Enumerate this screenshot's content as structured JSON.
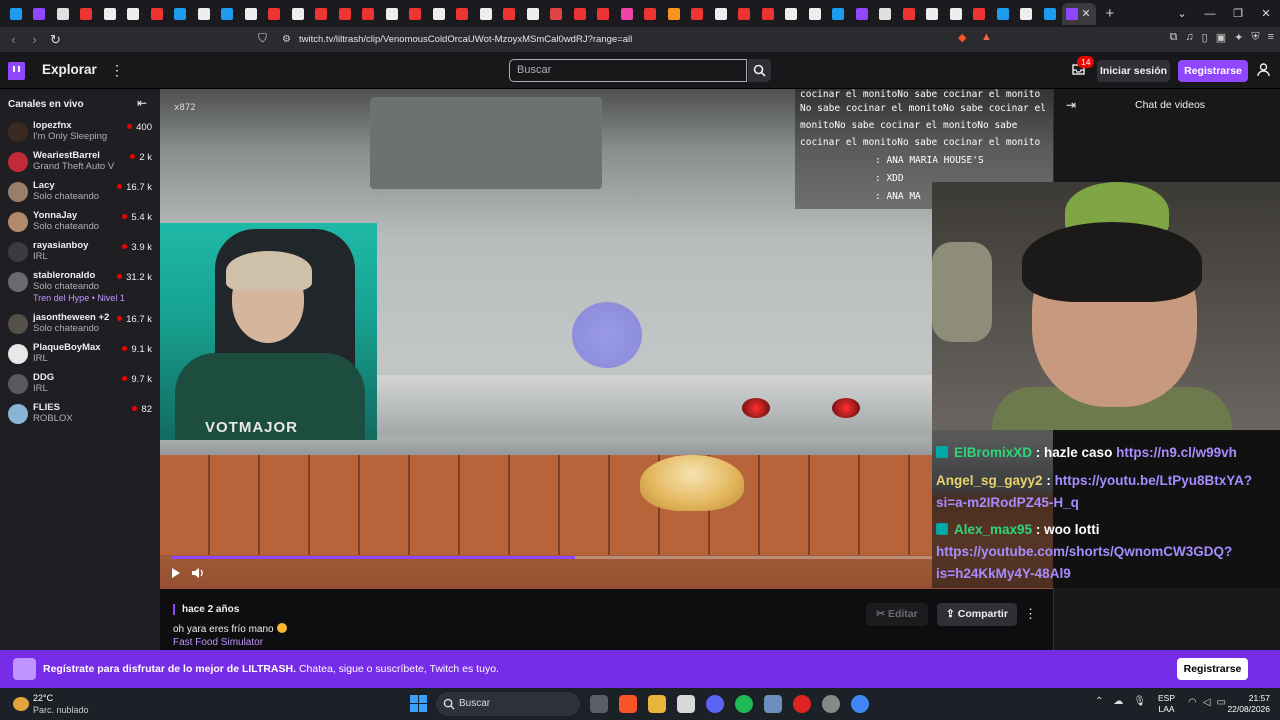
{
  "browser": {
    "url": "twitch.tv/liltrash/clip/VenomousColdOrcaUWot-MzoyxMSmCal0wdRJ?range=all",
    "tab_count_visible": 43
  },
  "topnav": {
    "explore_label": "Explorar",
    "search_placeholder": "Buscar",
    "notifications_count": "14",
    "login_label": "Iniciar sesión",
    "register_label": "Registrarse"
  },
  "sidebar": {
    "heading": "Canales en vivo",
    "channels": [
      {
        "name": "lopezfnx",
        "game": "I'm Only Sleeping",
        "viewers": "400",
        "color": "#3a2a22"
      },
      {
        "name": "WeariestBarrel",
        "game": "Grand Theft Auto V",
        "viewers": "2 k",
        "color": "#c22a3a"
      },
      {
        "name": "Lacy",
        "game": "Solo chateando",
        "viewers": "16.7 k",
        "color": "#9a7d6a"
      },
      {
        "name": "YonnaJay",
        "game": "Solo chateando",
        "viewers": "5.4 k",
        "color": "#b08a6a"
      },
      {
        "name": "rayasianboy",
        "game": "IRL",
        "viewers": "3.9 k",
        "color": "#3c3c40"
      },
      {
        "name": "stableronaldo",
        "game": "Solo chateando",
        "viewers": "31.2 k",
        "color": "#6a6a6e",
        "hype": "Tren del Hype • Nivel 1"
      },
      {
        "name": "jasontheween +2",
        "game": "Solo chateando",
        "viewers": "16.7 k",
        "color": "#55504a"
      },
      {
        "name": "PlaqueBoyMax",
        "game": "IRL",
        "viewers": "9.1 k",
        "color": "#e8e8e8"
      },
      {
        "name": "DDG",
        "game": "IRL",
        "viewers": "9.7 k",
        "color": "#5a5a5e"
      },
      {
        "name": "FLIES",
        "game": "ROBLOX",
        "viewers": "82",
        "color": "#8ab4d4"
      }
    ]
  },
  "video": {
    "counter_text": "x872",
    "progress": 0.53,
    "overlay_chat": [
      "cocinar el monitoNo sabe cocinar el monito",
      "No sabe cocinar el monitoNo sabe cocinar el",
      "monitoNo sabe cocinar el monitoNo sabe",
      "cocinar el monitoNo sabe cocinar el monito",
      ": ANA MARIA HOUSE'S",
      ": XDD",
      ": ANA MA"
    ],
    "webcam_shirt_text": "VOTMAJOR",
    "stream_chat": [
      {
        "user": "ElBromixXD",
        "msg": "hazle caso",
        "link": "https://n9.cl/w99vh"
      },
      {
        "user": "Angel_sg_gayy2",
        "msg": "",
        "link": "https://youtu.be/LtPyu8BtxYA?",
        "link2": "si=a-m2IRodPZ45-H_q"
      },
      {
        "user": "Alex_max95",
        "msg": "woo lotti",
        "link": "https://youtube.com/shorts/QwnomCW3GDQ?",
        "link2": "is=h24KkMy4Y-48Al9"
      }
    ]
  },
  "clip": {
    "time_ago": "hace 2 años",
    "title": "oh yara eres frío mano",
    "game": "Fast Food Simulator",
    "edit_label": "Editar",
    "share_label": "Compartir"
  },
  "chat_panel": {
    "title": "Chat de videos"
  },
  "banner": {
    "bold_text": "Regístrate para disfrutar de lo mejor de LILTRASH.",
    "text": " Chatea, sigue o suscríbete, Twitch es tuyo.",
    "button_label": "Registrarse"
  },
  "taskbar": {
    "temp": "22°C",
    "weather_desc": "Parc. nublado",
    "search_label": "Buscar",
    "lang_top": "ESP",
    "lang_bottom": "LAA",
    "time": "21:57",
    "date": "22/08/2026"
  },
  "colors": {
    "twitch_purple": "#9147ff",
    "banner_purple": "#772ce8",
    "live_red": "#eb0400"
  }
}
